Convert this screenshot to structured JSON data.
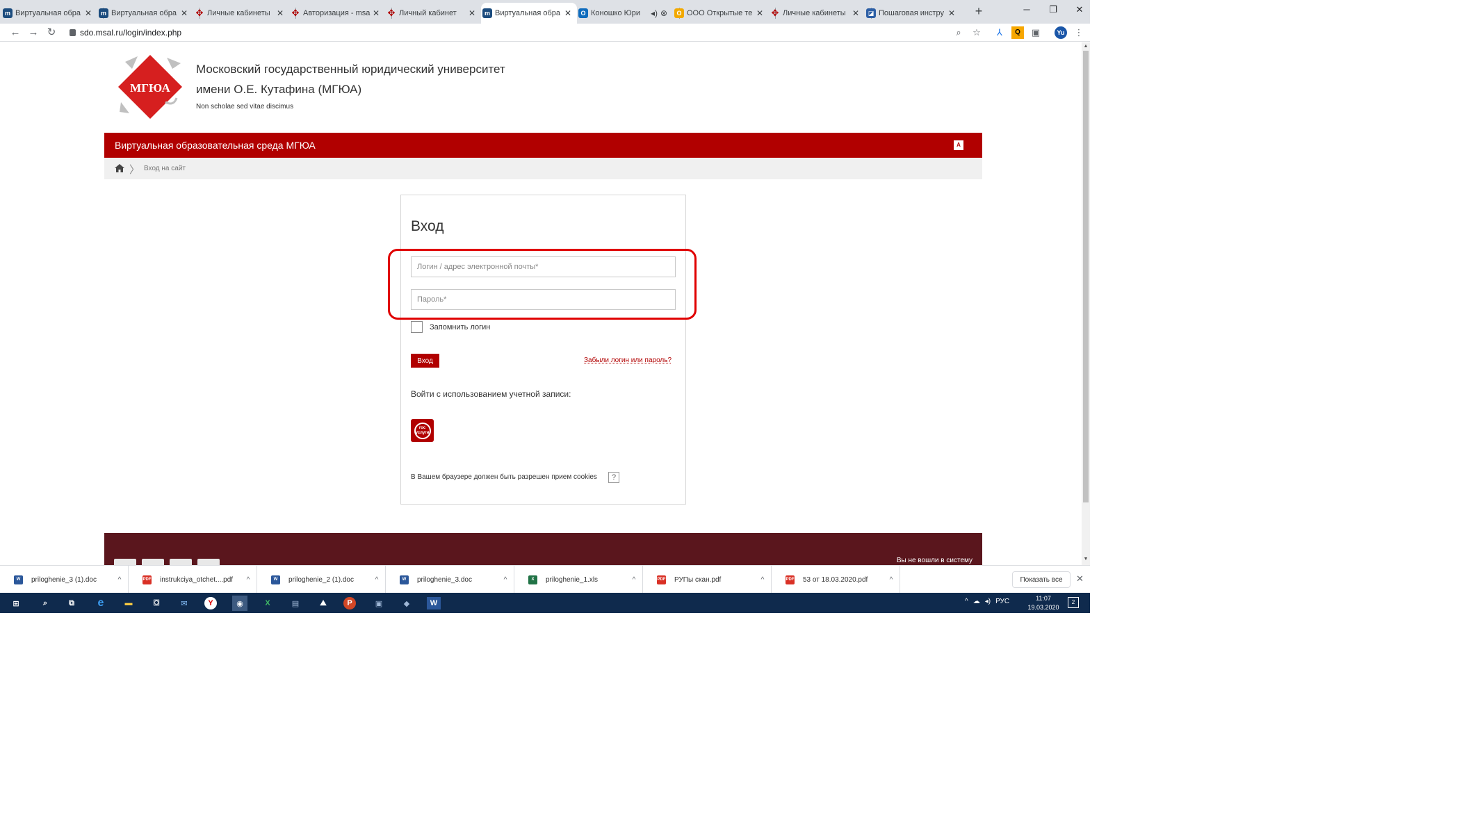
{
  "tabs": [
    {
      "title": "Виртуальная обра",
      "icon": "moodle-icon",
      "active": false
    },
    {
      "title": "Виртуальная обра",
      "icon": "moodle-icon",
      "active": false
    },
    {
      "title": "Личные кабинеты",
      "icon": "msal-icon",
      "active": false
    },
    {
      "title": "Авторизация - msa",
      "icon": "msal-icon",
      "active": false
    },
    {
      "title": "Личный кабинет",
      "icon": "msal-icon",
      "active": false
    },
    {
      "title": "Виртуальная обра",
      "icon": "moodle-icon",
      "active": true
    },
    {
      "title": "Коношко Юри",
      "icon": "outlook-icon",
      "active": false
    },
    {
      "title": "ООО Открытые те",
      "icon": "ooo-icon",
      "active": false
    },
    {
      "title": "Личные кабинеты",
      "icon": "msal-icon",
      "active": false
    },
    {
      "title": "Пошаговая инстру",
      "icon": "doc-icon",
      "active": false
    }
  ],
  "browser": {
    "url": "sdo.msal.ru/login/index.php",
    "avatar_initials": "Yu",
    "accent": "#1a56a8"
  },
  "site": {
    "logo_text": "МГЮА",
    "university_name_line1": "Московский государственный юридический университет",
    "university_name_line2": "имени О.Е. Кутафина (МГЮА)",
    "motto": "Non scholae sed vitae discimus",
    "banner_title": "Виртуальная образовательная среда МГЮА",
    "brand_color": "#b10000",
    "breadcrumb_current": "Вход на сайт"
  },
  "login": {
    "heading": "Вход",
    "username_placeholder": "Логин / адрес электронной почты*",
    "password_placeholder": "Пароль*",
    "remember_label": "Запомнить логин",
    "submit_label": "Вход",
    "forgot_link": "Забыли логин или пароль?",
    "alt_login_label": "Войти с использованием учетной записи:",
    "gosuslugi_text": "гос услуги",
    "cookies_note": "В Вашем браузере должен быть разрешен прием cookies",
    "help_symbol": "?"
  },
  "footer": {
    "status_text": "Вы не вошли в систему"
  },
  "downloads": {
    "items": [
      {
        "name": "priloghenie_3 (1).doc",
        "type": "word"
      },
      {
        "name": "instrukciya_otchet....pdf",
        "type": "pdf"
      },
      {
        "name": "priloghenie_2 (1).doc",
        "type": "word"
      },
      {
        "name": "priloghenie_3.doc",
        "type": "word"
      },
      {
        "name": "priloghenie_1.xls",
        "type": "xls"
      },
      {
        "name": "РУПы скан.pdf",
        "type": "pdf"
      },
      {
        "name": "53 от 18.03.2020.pdf",
        "type": "pdf"
      }
    ],
    "show_all_label": "Показать все"
  },
  "taskbar": {
    "language": "РУС",
    "time": "11:07",
    "date": "19.03.2020",
    "notification_count": "2"
  }
}
